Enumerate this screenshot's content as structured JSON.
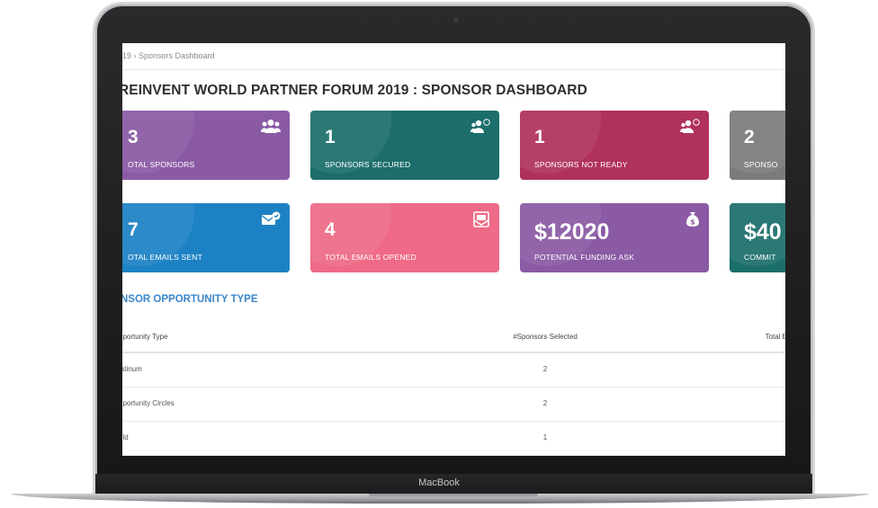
{
  "device": {
    "brand": "MacBook"
  },
  "breadcrumb": "19  ›  Sponsors Dashboard",
  "page_title": "REINVENT WORLD PARTNER FORUM 2019 : SPONSOR DASHBOARD",
  "cards_row1": [
    {
      "value": "3",
      "label": "OTAL SPONSORS",
      "icon": "users-icon",
      "color": "#8a5aa4"
    },
    {
      "value": "1",
      "label": "SPONSORS SECURED",
      "icon": "users-check-icon",
      "color": "#1b6e6b"
    },
    {
      "value": "1",
      "label": "SPONSORS NOT READY",
      "icon": "users-x-icon",
      "color": "#b0325a"
    },
    {
      "value": "2",
      "label": "SPONSO",
      "icon": "users-icon",
      "color": "#7b7b7b"
    }
  ],
  "cards_row2": [
    {
      "value": "7",
      "label": "OTAL EMAILS SENT",
      "icon": "mail-check-icon",
      "color": "#1d82c4"
    },
    {
      "value": "4",
      "label": "TOTAL EMAILS OPENED",
      "icon": "mail-open-icon",
      "color": "#ee6a86"
    },
    {
      "value": "$12020",
      "label": "POTENTIAL FUNDING ASK",
      "icon": "money-bag-icon",
      "color": "#8a5aa4"
    },
    {
      "value": "$40",
      "label": "COMMIT",
      "icon": "money-icon",
      "color": "#1b6e6b"
    }
  ],
  "section_title": "NSOR OPPORTUNITY TYPE",
  "table": {
    "headers": [
      "pportunity Type",
      "#Sponsors Selected",
      "Total E"
    ],
    "rows": [
      [
        "latinum",
        "2",
        "‘"
      ],
      [
        "pportunity Circles",
        "2",
        "‘"
      ],
      [
        "old",
        "1",
        "‘"
      ]
    ]
  }
}
